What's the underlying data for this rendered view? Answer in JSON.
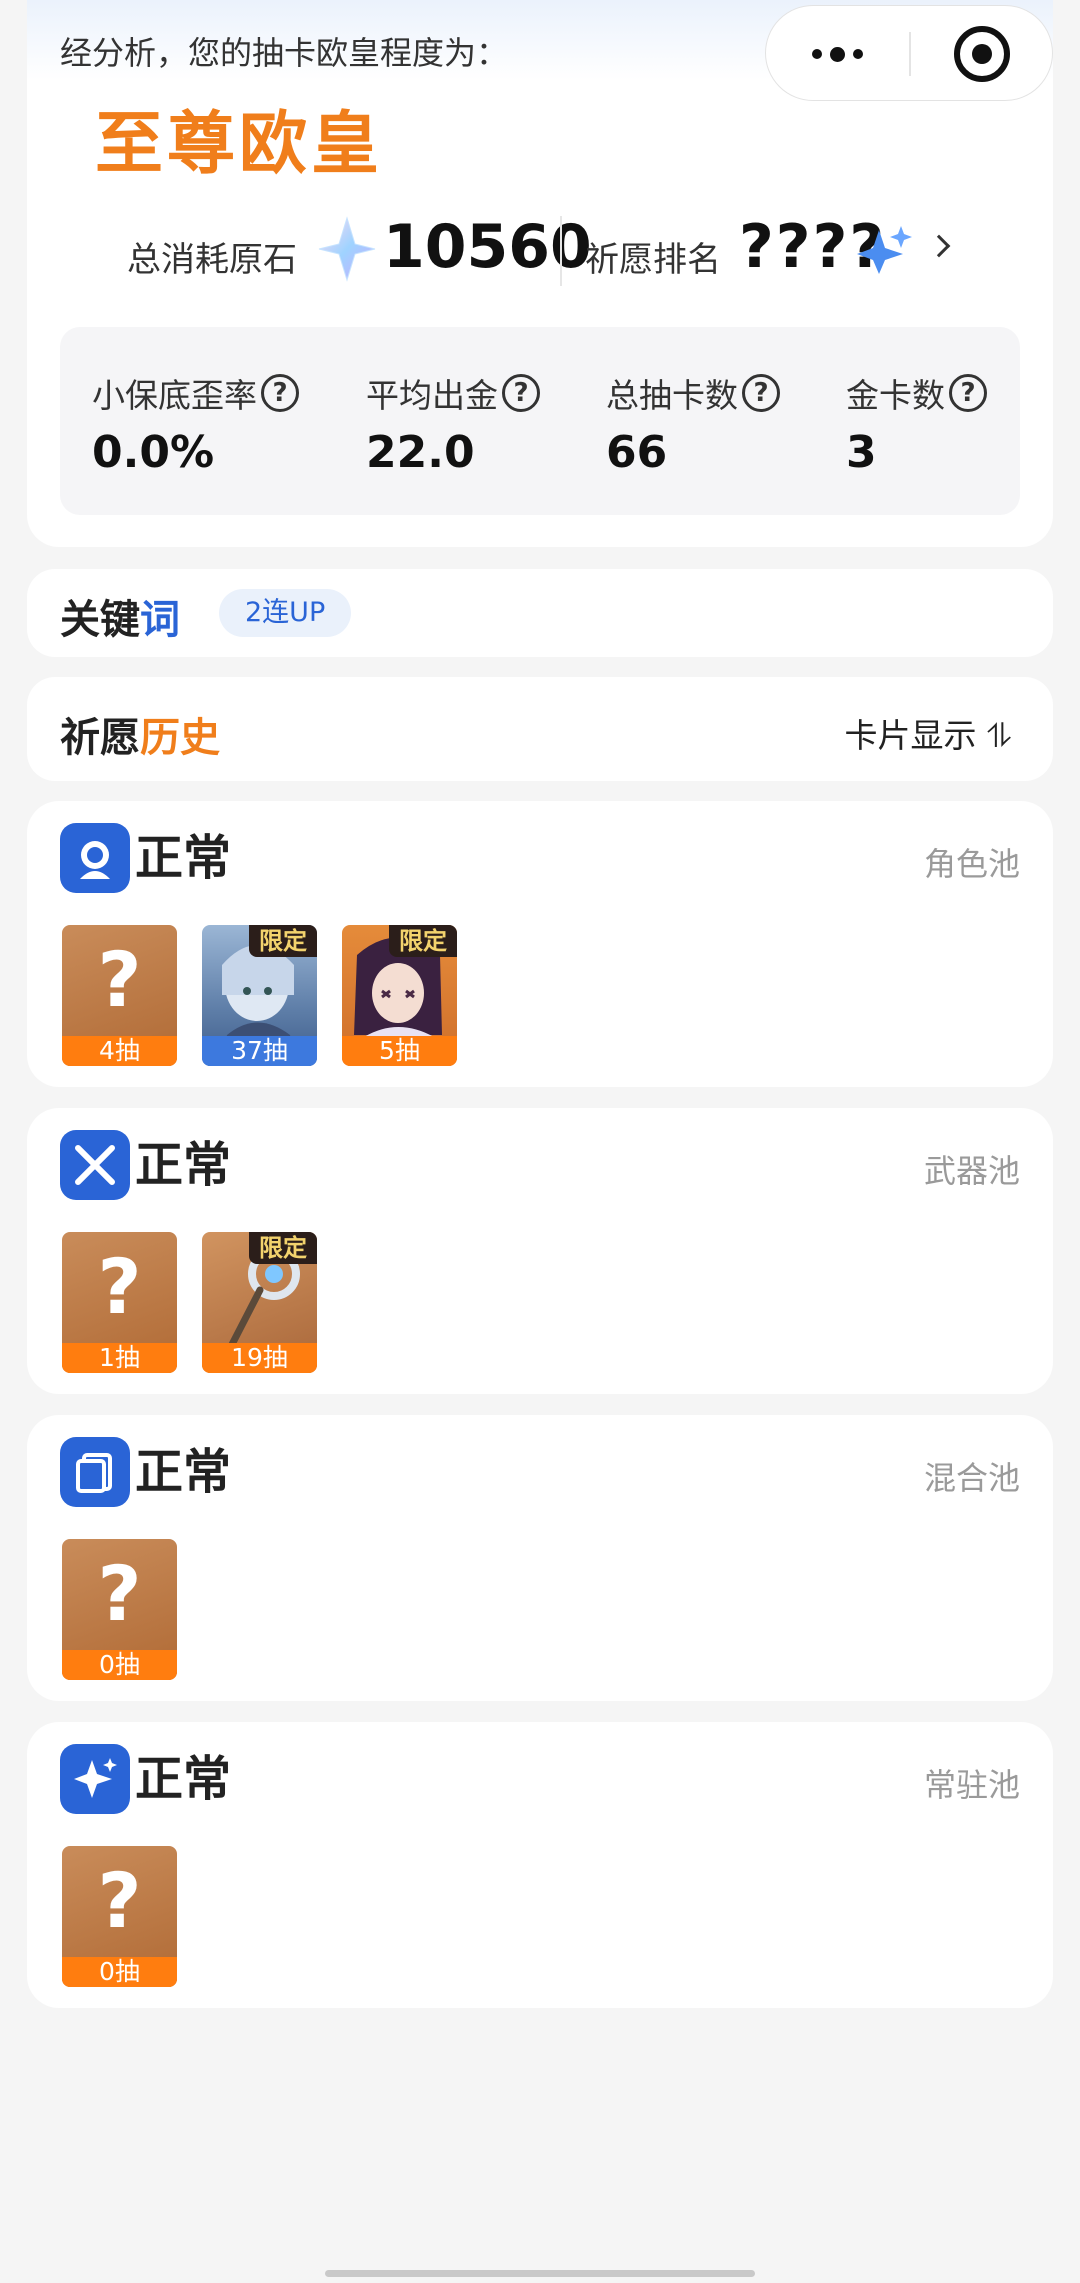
{
  "summary": {
    "intro": "经分析，您的抽卡欧皇程度为：",
    "rank_title": "至尊欧皇",
    "total_cost_label": "总消耗原石",
    "total_cost_value": "10560",
    "rank_label": "祈愿排名",
    "rank_value": "????",
    "stats": [
      {
        "label": "小保底歪率",
        "value": "0.0%"
      },
      {
        "label": "平均出金",
        "value": "22.0"
      },
      {
        "label": "总抽卡数",
        "value": "66"
      },
      {
        "label": "金卡数",
        "value": "3"
      }
    ]
  },
  "keywords": {
    "title_a": "关键",
    "title_b": "词",
    "tag": "2连UP"
  },
  "history": {
    "title_a": "祈愿",
    "title_b": "历史",
    "toggle": "卡片显示 ⥮"
  },
  "pools": [
    {
      "status": "正常",
      "type": "角色池",
      "items": [
        {
          "count": "4抽",
          "kind": "unknown"
        },
        {
          "count": "37抽",
          "kind": "character",
          "limited": "限定"
        },
        {
          "count": "5抽",
          "kind": "character",
          "limited": "限定"
        }
      ]
    },
    {
      "status": "正常",
      "type": "武器池",
      "items": [
        {
          "count": "1抽",
          "kind": "unknown"
        },
        {
          "count": "19抽",
          "kind": "weapon",
          "limited": "限定"
        }
      ]
    },
    {
      "status": "正常",
      "type": "混合池",
      "items": [
        {
          "count": "0抽",
          "kind": "unknown"
        }
      ]
    },
    {
      "status": "正常",
      "type": "常驻池",
      "items": [
        {
          "count": "0抽",
          "kind": "unknown"
        }
      ]
    }
  ],
  "placeholder_glyph": "?",
  "icons": {
    "more": "more-dots-icon",
    "close": "target-circle-icon",
    "gem": "primogem-icon",
    "rank": "sparkle-chart-icon",
    "chevron": "chevron-right-icon",
    "help": "question-circle-icon",
    "help_glyph": "?",
    "sort": "sort-arrows-icon"
  },
  "colors": {
    "accent_orange": "#f07e1b",
    "accent_blue": "#2a64d6",
    "pull_count_bar": "#ff7d0f"
  }
}
